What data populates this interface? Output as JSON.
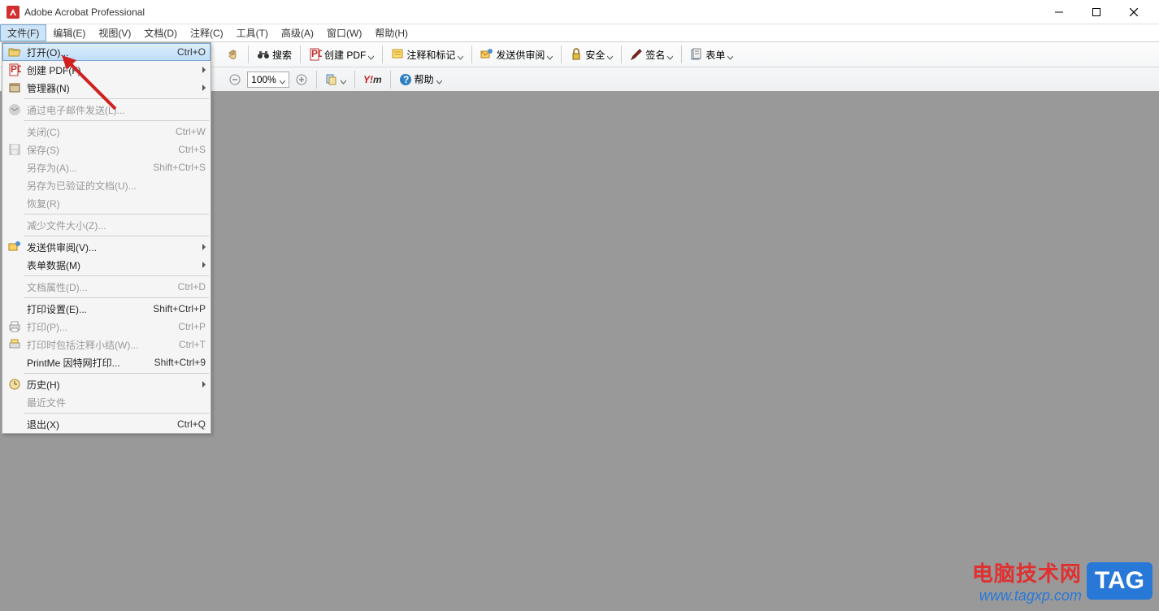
{
  "title": "Adobe Acrobat Professional",
  "menubar": [
    "文件(F)",
    "编辑(E)",
    "视图(V)",
    "文档(D)",
    "注释(C)",
    "工具(T)",
    "高级(A)",
    "窗口(W)",
    "帮助(H)"
  ],
  "toolbar1": {
    "search": "搜索",
    "create_pdf": "创建 PDF",
    "comment_mark": "注释和标记",
    "send_review": "发送供审阅",
    "security": "安全",
    "sign": "签名",
    "forms": "表单"
  },
  "toolbar2": {
    "zoom_value": "100%",
    "help": "帮助"
  },
  "dropdown": {
    "open": {
      "label": "打开(O)...",
      "shortcut": "Ctrl+O"
    },
    "create_pdf": {
      "label": "创建 PDF(F)"
    },
    "organizer": {
      "label": "管理器(N)"
    },
    "email": {
      "label": "通过电子邮件发送(L)..."
    },
    "close": {
      "label": "关闭(C)",
      "shortcut": "Ctrl+W"
    },
    "save": {
      "label": "保存(S)",
      "shortcut": "Ctrl+S"
    },
    "save_as": {
      "label": "另存为(A)...",
      "shortcut": "Shift+Ctrl+S"
    },
    "save_cert": {
      "label": "另存为已验证的文档(U)..."
    },
    "revert": {
      "label": "恢复(R)"
    },
    "reduce": {
      "label": "减少文件大小(Z)..."
    },
    "send_review": {
      "label": "发送供审阅(V)..."
    },
    "form_data": {
      "label": "表单数据(M)"
    },
    "doc_props": {
      "label": "文档属性(D)...",
      "shortcut": "Ctrl+D"
    },
    "print_setup": {
      "label": "打印设置(E)...",
      "shortcut": "Shift+Ctrl+P"
    },
    "print": {
      "label": "打印(P)...",
      "shortcut": "Ctrl+P"
    },
    "print_comments": {
      "label": "打印时包括注释小结(W)...",
      "shortcut": "Ctrl+T"
    },
    "printme": {
      "label": "PrintMe 因特网打印...",
      "shortcut": "Shift+Ctrl+9"
    },
    "history": {
      "label": "历史(H)"
    },
    "recent": {
      "label": "最近文件"
    },
    "exit": {
      "label": "退出(X)",
      "shortcut": "Ctrl+Q"
    }
  },
  "watermark": {
    "cn": "电脑技术网",
    "url": "www.tagxp.com",
    "tag": "TAG"
  }
}
